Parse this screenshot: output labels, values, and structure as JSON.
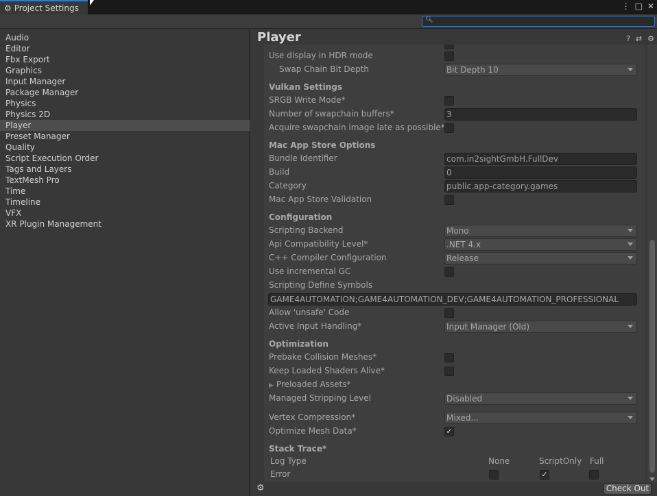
{
  "window": {
    "tab_title": "Project Settings",
    "tab_icon": "gear-icon",
    "menu_icon": "⋮",
    "maximize_icon": "□",
    "close_icon": "✕"
  },
  "search": {
    "placeholder": "",
    "icon": "search-icon"
  },
  "sidebar": {
    "items": [
      {
        "label": "Audio"
      },
      {
        "label": "Editor"
      },
      {
        "label": "Fbx Export"
      },
      {
        "label": "Graphics"
      },
      {
        "label": "Input Manager"
      },
      {
        "label": "Package Manager"
      },
      {
        "label": "Physics"
      },
      {
        "label": "Physics 2D"
      },
      {
        "label": "Player"
      },
      {
        "label": "Preset Manager"
      },
      {
        "label": "Quality"
      },
      {
        "label": "Script Execution Order"
      },
      {
        "label": "Tags and Layers"
      },
      {
        "label": "TextMesh Pro"
      },
      {
        "label": "Time"
      },
      {
        "label": "Timeline"
      },
      {
        "label": "VFX"
      },
      {
        "label": "XR Plugin Management"
      }
    ],
    "selected": "Player"
  },
  "main": {
    "title": "Player",
    "help_icon": "?",
    "preset_icon": "⇄",
    "settings_icon": "⚙"
  },
  "settings": {
    "hdr_display": "Use display in HDR mode",
    "swap_chain_label": "Swap Chain Bit Depth",
    "swap_chain_value": "Bit Depth 10",
    "vulkan_header": "Vulkan Settings",
    "srgb_write": "SRGB Write Mode*",
    "swapchain_buffers_label": "Number of swapchain buffers*",
    "swapchain_buffers_value": "3",
    "acquire_late": "Acquire swapchain image late as possible*",
    "mac_header": "Mac App Store Options",
    "bundle_label": "Bundle Identifier",
    "bundle_value": "com.in2sightGmbH.FullDev",
    "build_label": "Build",
    "build_value": "0",
    "category_label": "Category",
    "category_value": "public.app-category.games",
    "mac_validation": "Mac App Store Validation",
    "config_header": "Configuration",
    "scripting_backend_label": "Scripting Backend",
    "scripting_backend_value": "Mono",
    "api_compat_label": "Api Compatibility Level*",
    "api_compat_value": ".NET 4.x",
    "cpp_compiler_label": "C++ Compiler Configuration",
    "cpp_compiler_value": "Release",
    "incremental_gc": "Use incremental GC",
    "define_symbols_label": "Scripting Define Symbols",
    "define_symbols_value": "GAME4AUTOMATION;GAME4AUTOMATION_DEV;GAME4AUTOMATION_PROFESSIONAL",
    "unsafe_code": "Allow 'unsafe' Code",
    "input_handling_label": "Active Input Handling*",
    "input_handling_value": "Input Manager (Old)",
    "optimization_header": "Optimization",
    "prebake": "Prebake Collision Meshes*",
    "keep_shaders": "Keep Loaded Shaders Alive*",
    "preloaded_assets": "Preloaded Assets*",
    "stripping_label": "Managed Stripping Level",
    "stripping_value": "Disabled",
    "vertex_compression_label": "Vertex Compression*",
    "vertex_compression_value": "Mixed...",
    "optimize_mesh": "Optimize Mesh Data*",
    "optimize_mesh_checked": "✓",
    "stack_trace_header": "Stack Trace*",
    "log_type_label": "Log Type",
    "col_none": "None",
    "col_script_only": "ScriptOnly",
    "col_full": "Full",
    "error_label": "Error",
    "error_script_only_checked": "✓"
  },
  "footer": {
    "checkout_label": "Check Out",
    "gear_icon": "gear-icon"
  }
}
